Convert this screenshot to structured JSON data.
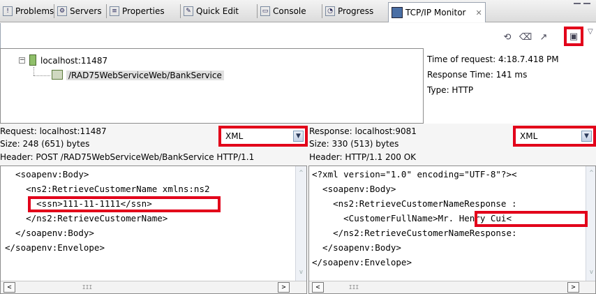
{
  "tabs": [
    {
      "label": "Problems",
      "icon": "problems-icon"
    },
    {
      "label": "Servers",
      "icon": "servers-icon"
    },
    {
      "label": "Properties",
      "icon": "properties-icon"
    },
    {
      "label": "Quick Edit",
      "icon": "quick-edit-icon"
    },
    {
      "label": "Console",
      "icon": "console-icon"
    },
    {
      "label": "Progress",
      "icon": "progress-icon"
    }
  ],
  "active_tab": {
    "label": "TCP/IP Monitor",
    "icon": "tcpip-monitor-icon",
    "close": "✕"
  },
  "tree": {
    "server": "localhost:11487",
    "request_path": "/RAD75WebServiceWeb/BankService"
  },
  "info": {
    "time_of_request": "Time of request: 4:18.7.418 PM",
    "response_time": "Response Time: 141 ms",
    "type": "Type: HTTP"
  },
  "request": {
    "host": "Request: localhost:11487",
    "size": "Size: 248 (651) bytes",
    "header": "Header: POST /RAD75WebServiceWeb/BankService HTTP/1.1",
    "format": "XML",
    "lines": [
      "  <soapenv:Body>",
      "    <ns2:RetrieveCustomerName xmlns:ns2",
      "      <ssn>111-11-1111</ssn>",
      "    </ns2:RetrieveCustomerName>",
      "  </soapenv:Body>",
      "</soapenv:Envelope>"
    ]
  },
  "response": {
    "host": "Response: localhost:9081",
    "size": "Size: 330 (513) bytes",
    "header": "Header: HTTP/1.1 200 OK",
    "format": "XML",
    "lines": [
      "<?xml version=\"1.0\" encoding=\"UTF-8\"?><",
      "  <soapenv:Body>",
      "    <ns2:RetrieveCustomerNameResponse :",
      "      <CustomerFullName>Mr. Henry Cui<",
      "    </ns2:RetrieveCustomerNameResponse:",
      "  </soapenv:Body>",
      "</soapenv:Envelope>"
    ]
  },
  "scroll": {
    "left": "<",
    "right": ">",
    "up": "^",
    "down": "v",
    "thumb": "III"
  }
}
